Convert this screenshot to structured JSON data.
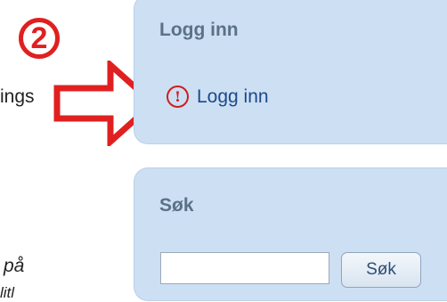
{
  "left_fragments": {
    "line1": "ings",
    "line2": "på",
    "line3": "litl"
  },
  "annotation": {
    "step_number": "2",
    "accent_color": "#e02020"
  },
  "login_panel": {
    "title": "Logg inn",
    "link_label": "Logg inn",
    "link_icon": "info-icon",
    "icon_glyph": "!"
  },
  "search_panel": {
    "title": "Søk",
    "input_value": "",
    "input_placeholder": "",
    "button_label": "Søk"
  }
}
